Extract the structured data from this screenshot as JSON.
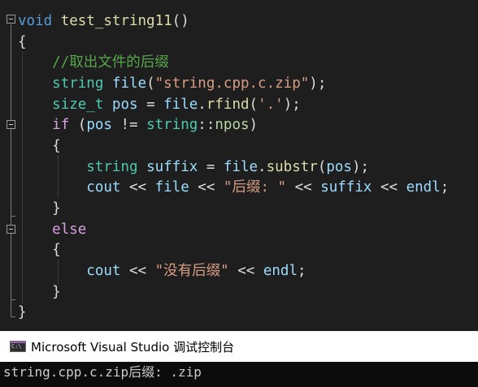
{
  "editor": {
    "lines": [
      [
        [
          "kw",
          "void"
        ],
        [
          "pl",
          " "
        ],
        [
          "fn",
          "test_string11"
        ],
        [
          "pl",
          "()"
        ]
      ],
      [
        [
          "pl",
          "{"
        ]
      ],
      [
        [
          "pl",
          "    "
        ],
        [
          "cm",
          "//取出文件的后缀"
        ]
      ],
      [
        [
          "pl",
          "    "
        ],
        [
          "ty",
          "string"
        ],
        [
          "pl",
          " "
        ],
        [
          "var",
          "file"
        ],
        [
          "pl",
          "("
        ],
        [
          "str",
          "\"string.cpp.c.zip\""
        ],
        [
          "pl",
          ");"
        ]
      ],
      [
        [
          "pl",
          "    "
        ],
        [
          "ty",
          "size_t"
        ],
        [
          "pl",
          " "
        ],
        [
          "var",
          "pos"
        ],
        [
          "pl",
          " = "
        ],
        [
          "var",
          "file"
        ],
        [
          "pl",
          "."
        ],
        [
          "fn",
          "rfind"
        ],
        [
          "pl",
          "("
        ],
        [
          "str",
          "'.'"
        ],
        [
          "pl",
          ");"
        ]
      ],
      [
        [
          "pl",
          "    "
        ],
        [
          "kw2",
          "if"
        ],
        [
          "pl",
          " ("
        ],
        [
          "var",
          "pos"
        ],
        [
          "pl",
          " != "
        ],
        [
          "ty",
          "string"
        ],
        [
          "pl",
          "::"
        ],
        [
          "np",
          "npos"
        ],
        [
          "pl",
          ")"
        ]
      ],
      [
        [
          "pl",
          "    {"
        ]
      ],
      [
        [
          "pl",
          "        "
        ],
        [
          "ty",
          "string"
        ],
        [
          "pl",
          " "
        ],
        [
          "var",
          "suffix"
        ],
        [
          "pl",
          " = "
        ],
        [
          "var",
          "file"
        ],
        [
          "pl",
          "."
        ],
        [
          "fn",
          "substr"
        ],
        [
          "pl",
          "("
        ],
        [
          "var",
          "pos"
        ],
        [
          "pl",
          ");"
        ]
      ],
      [
        [
          "pl",
          "        "
        ],
        [
          "var",
          "cout"
        ],
        [
          "pl",
          " << "
        ],
        [
          "var",
          "file"
        ],
        [
          "pl",
          " << "
        ],
        [
          "str",
          "\"后缀: \""
        ],
        [
          "pl",
          " << "
        ],
        [
          "var",
          "suffix"
        ],
        [
          "pl",
          " << "
        ],
        [
          "var",
          "endl"
        ],
        [
          "pl",
          ";"
        ]
      ],
      [
        [
          "pl",
          "    }"
        ]
      ],
      [
        [
          "pl",
          "    "
        ],
        [
          "kw2",
          "else"
        ]
      ],
      [
        [
          "pl",
          "    {"
        ]
      ],
      [
        [
          "pl",
          "        "
        ],
        [
          "var",
          "cout"
        ],
        [
          "pl",
          " << "
        ],
        [
          "str",
          "\"没有后缀\""
        ],
        [
          "pl",
          " << "
        ],
        [
          "var",
          "endl"
        ],
        [
          "pl",
          ";"
        ]
      ],
      [
        [
          "pl",
          "    }"
        ]
      ],
      [
        [
          "pl",
          "}"
        ]
      ]
    ]
  },
  "console": {
    "title": "Microsoft Visual Studio 调试控制台",
    "output": "string.cpp.c.zip后缀: .zip"
  }
}
